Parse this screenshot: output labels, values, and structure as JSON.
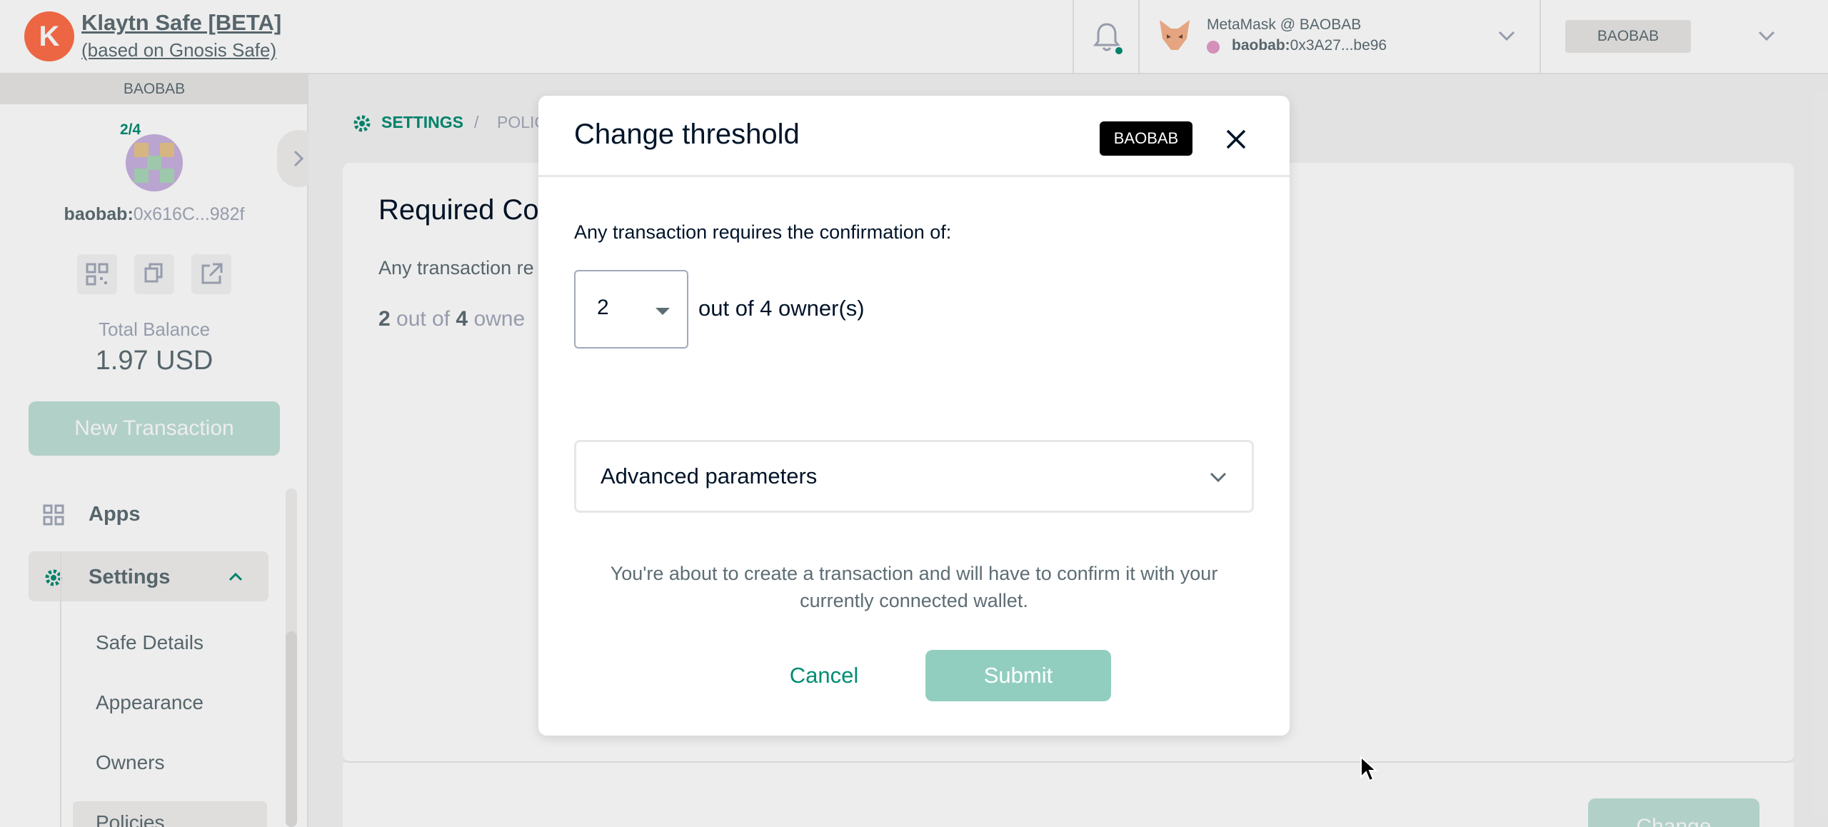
{
  "header": {
    "app_title": "Klaytn Safe [BETA]",
    "app_subtitle": "(based on Gnosis Safe)",
    "wallet_name": "MetaMask @ BAOBAB",
    "wallet_network_prefix": "baobab:",
    "wallet_address": "0x3A27...be96",
    "network_label": "BAOBAB",
    "accent_color": "#008c73"
  },
  "sidebar": {
    "network_bar": "BAOBAB",
    "threshold": "2/4",
    "safe_prefix": "baobab:",
    "safe_address": "0x616C...982f",
    "total_balance_label": "Total Balance",
    "total_balance_value": "1.97 USD",
    "new_tx_label": "New Transaction",
    "nav": [
      {
        "label": "Apps",
        "icon": "apps-icon"
      },
      {
        "label": "Settings",
        "icon": "gear-icon"
      }
    ],
    "settings_sub": [
      "Safe Details",
      "Appearance",
      "Owners",
      "Policies"
    ]
  },
  "main": {
    "breadcrumb_1": "SETTINGS",
    "breadcrumb_sep": "/",
    "breadcrumb_2": "POLIC",
    "card_title": "Required Co",
    "card_text": "Any transaction re",
    "card_value_num": "2",
    "card_value_mid": " out of ",
    "card_value_total": "4",
    "card_value_suffix": " owne",
    "change_label": "Change"
  },
  "modal": {
    "title": "Change threshold",
    "network_badge": "BAOBAB",
    "label": "Any transaction requires the confirmation of:",
    "threshold_value": "2",
    "threshold_suffix": "out of 4 owner(s)",
    "advanced_label": "Advanced parameters",
    "note": "You're about to create a transaction and will have to confirm it with your currently connected wallet.",
    "cancel_label": "Cancel",
    "submit_label": "Submit"
  }
}
